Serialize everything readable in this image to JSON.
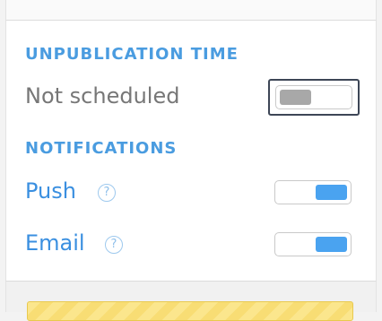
{
  "unpublication": {
    "heading": "UNPUBLICATION TIME",
    "status": "Not scheduled",
    "toggle_on": false
  },
  "notifications": {
    "heading": "NOTIFICATIONS",
    "items": [
      {
        "label": "Push",
        "help_icon": "?",
        "toggle_on": true
      },
      {
        "label": "Email",
        "help_icon": "?",
        "toggle_on": true
      }
    ]
  },
  "colors": {
    "accent": "#4a9ce0",
    "toggle_on": "#4aa3f0",
    "toggle_off": "#a8a8a8",
    "warning_box": "#fbe68d"
  }
}
